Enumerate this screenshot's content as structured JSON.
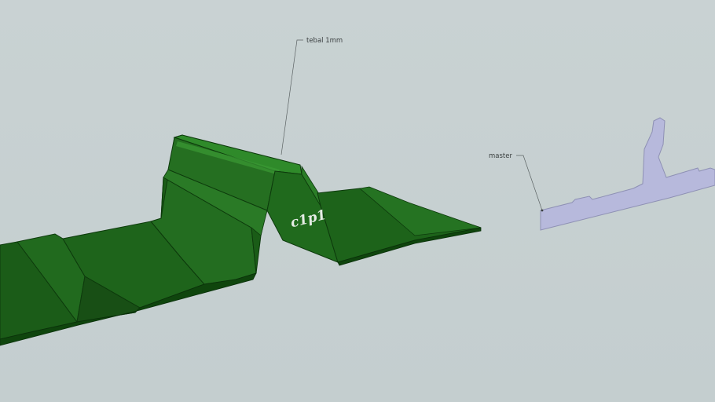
{
  "scene": {
    "background_color": "#c6d0d1",
    "panel_color": "#1f6a1c",
    "panel_edge_color": "#0d3a0c",
    "section_color": "#b7b9dc",
    "section_edge_color": "#8e90b4"
  },
  "annotations": {
    "thickness_label": "tebal 1mm",
    "section_label": "master"
  },
  "model": {
    "embossed_text": "c1p1"
  }
}
